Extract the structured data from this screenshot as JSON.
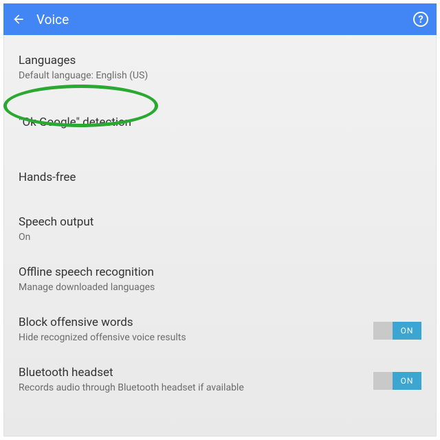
{
  "header": {
    "title": "Voice"
  },
  "items": [
    {
      "title": "Languages",
      "subtitle": "Default language: English (US)",
      "name": "languages-item",
      "toggle": null
    },
    {
      "title": "\"Ok Google\" detection",
      "subtitle": null,
      "name": "ok-google-detection-item",
      "toggle": null
    },
    {
      "title": "Hands-free",
      "subtitle": null,
      "name": "hands-free-item",
      "toggle": null
    },
    {
      "title": "Speech output",
      "subtitle": "On",
      "name": "speech-output-item",
      "toggle": null
    },
    {
      "title": "Offline speech recognition",
      "subtitle": "Manage downloaded languages",
      "name": "offline-speech-recognition-item",
      "toggle": null
    },
    {
      "title": "Block offensive words",
      "subtitle": "Hide recognized offensive voice results",
      "name": "block-offensive-words-item",
      "toggle": {
        "state": "on",
        "label": "ON"
      }
    },
    {
      "title": "Bluetooth headset",
      "subtitle": "Records audio through Bluetooth headset if available",
      "name": "bluetooth-headset-item",
      "toggle": {
        "state": "on",
        "label": "ON"
      }
    }
  ],
  "annotation": {
    "highlights": "ok-google-detection-item",
    "color": "#2aa831"
  }
}
